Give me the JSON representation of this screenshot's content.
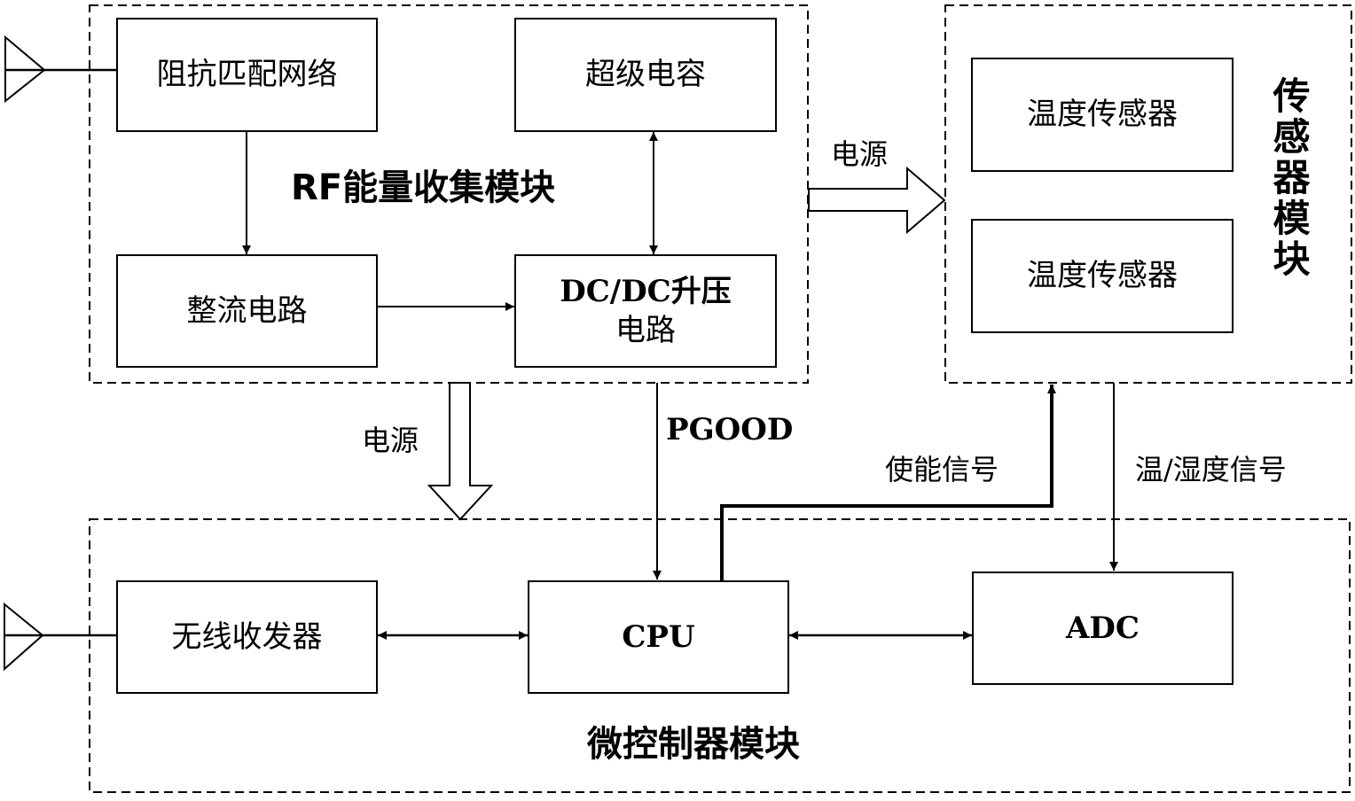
{
  "modules": {
    "rf": {
      "title": "RF能量收集模块",
      "blocks": {
        "impedance": "阻抗匹配网络",
        "supercap": "超级电容",
        "rectifier": "整流电路",
        "dcdc_line1": "DC/DC升压",
        "dcdc_line2": "电路"
      }
    },
    "sensor": {
      "title": "传感器模块",
      "blocks": {
        "sensor1": "温度传感器",
        "sensor2": "温度传感器"
      }
    },
    "mcu": {
      "title": "微控制器模块",
      "blocks": {
        "transceiver": "无线收发器",
        "cpu": "CPU",
        "adc": "ADC"
      }
    }
  },
  "edges": {
    "power_to_sensor": "电源",
    "power_to_mcu": "电源",
    "pgood": "PGOOD",
    "enable_signal": "使能信号",
    "temp_humidity_signal": "温/湿度信号"
  },
  "colors": {
    "stroke": "#000000",
    "background": "#ffffff"
  }
}
